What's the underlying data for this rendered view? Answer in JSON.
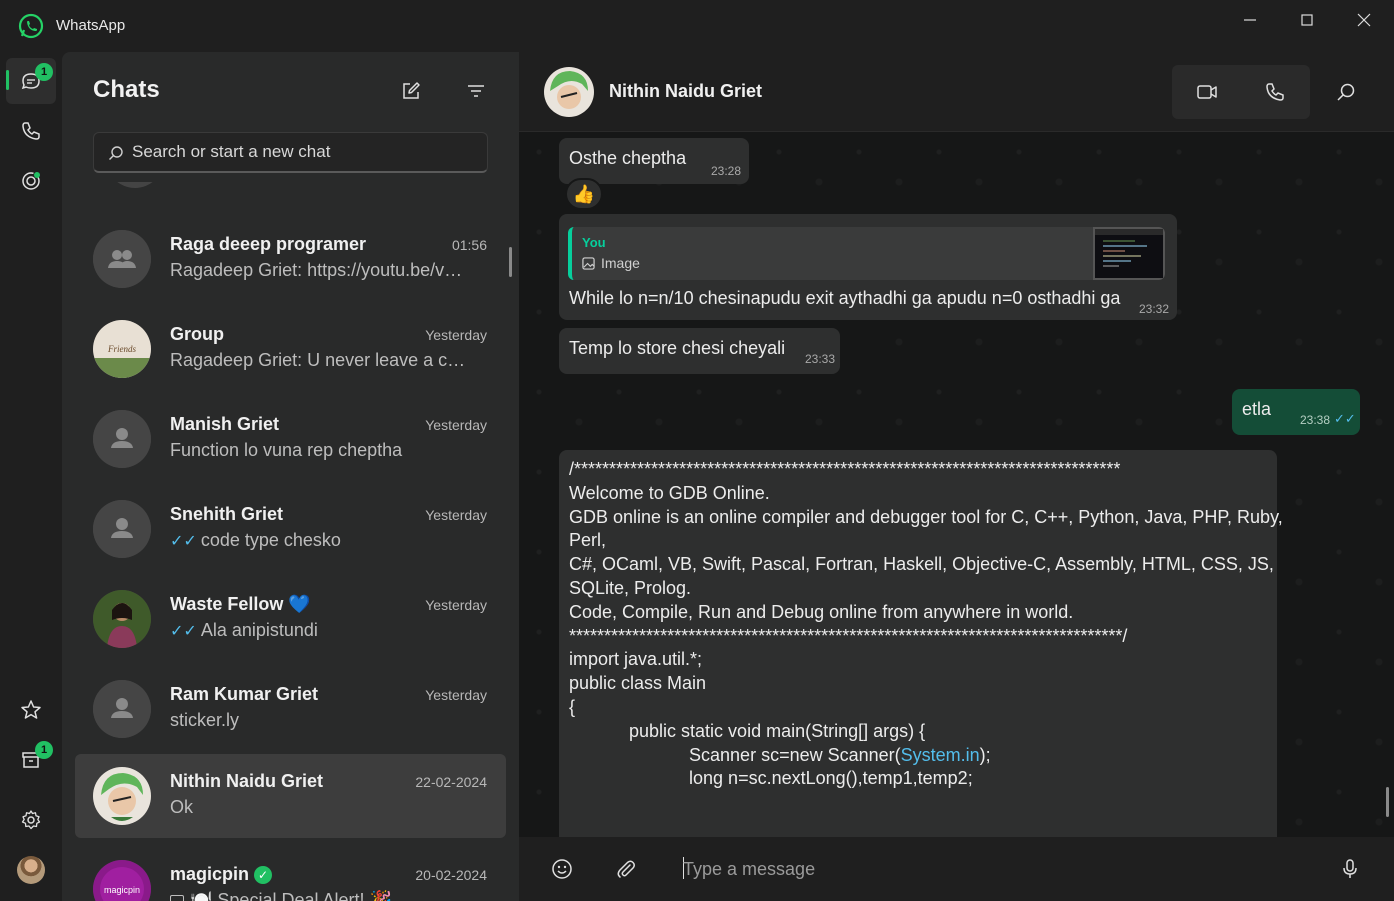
{
  "window": {
    "app_title": "WhatsApp"
  },
  "rail": {
    "chats_badge": "1",
    "archive_badge": "1"
  },
  "list": {
    "title": "Chats",
    "search_placeholder": "Search or start a new chat",
    "chats": [
      {
        "name": "Raga   deeep programer",
        "time": "01:56",
        "preview": "Ragadeep Griet: https://youtu.be/vK...",
        "ticks": ""
      },
      {
        "name": "Group",
        "time": "Yesterday",
        "preview": "Ragadeep Griet: U never leave a cha...",
        "ticks": ""
      },
      {
        "name": "Manish Griet",
        "time": "Yesterday",
        "preview": "Function lo vuna rep cheptha",
        "ticks": ""
      },
      {
        "name": "Snehith Griet",
        "time": "Yesterday",
        "preview": "code type chesko",
        "ticks": "✓✓"
      },
      {
        "name": "Waste Fellow 💙",
        "time": "Yesterday",
        "preview": "Ala anipistundi",
        "ticks": "✓✓"
      },
      {
        "name": "Ram Kumar Griet",
        "time": "Yesterday",
        "preview": "sticker.ly",
        "ticks": ""
      },
      {
        "name": "Nithin Naidu Griet",
        "time": "22-02-2024",
        "preview": "Ok",
        "ticks": ""
      },
      {
        "name": "magicpin",
        "time": "20-02-2024",
        "preview": "🍽️ Special Deal Alert! 🎉",
        "ticks": ""
      }
    ]
  },
  "conversation": {
    "contact_name": "Nithin Naidu Griet",
    "composer_placeholder": "Type a message",
    "messages": {
      "m1": {
        "text": "Osthe cheptha",
        "time": "23:28",
        "reaction": "👍"
      },
      "m2": {
        "quote_author": "You",
        "quote_text": "Image",
        "text": "While lo n=n/10 chesinapudu exit aythadhi ga apudu n=0 osthadhi ga",
        "time": "23:32"
      },
      "m3": {
        "text": "Temp lo store chesi cheyali",
        "time": "23:33"
      },
      "m4": {
        "text": "etla",
        "time": "23:38"
      },
      "code": {
        "lines": [
          "/******************************************************************************",
          "",
          "Welcome to GDB Online.",
          "GDB online is an online compiler and debugger tool for C, C++, Python, Java, PHP, Ruby,",
          "Perl,",
          "C#, OCaml, VB, Swift, Pascal, Fortran, Haskell, Objective-C, Assembly, HTML, CSS, JS,",
          "SQLite, Prolog.",
          "Code, Compile, Run and Debug online from anywhere in world.",
          "",
          "*******************************************************************************/",
          "import java.util.*;",
          "public class Main",
          "{",
          "            public static void main(String[] args) {",
          "                        long n=sc.nextLong(),temp1,temp2;"
        ],
        "scanner_prefix": "                        Scanner sc=new Scanner(",
        "scanner_link": "System.in",
        "scanner_suffix": ");"
      }
    }
  }
}
